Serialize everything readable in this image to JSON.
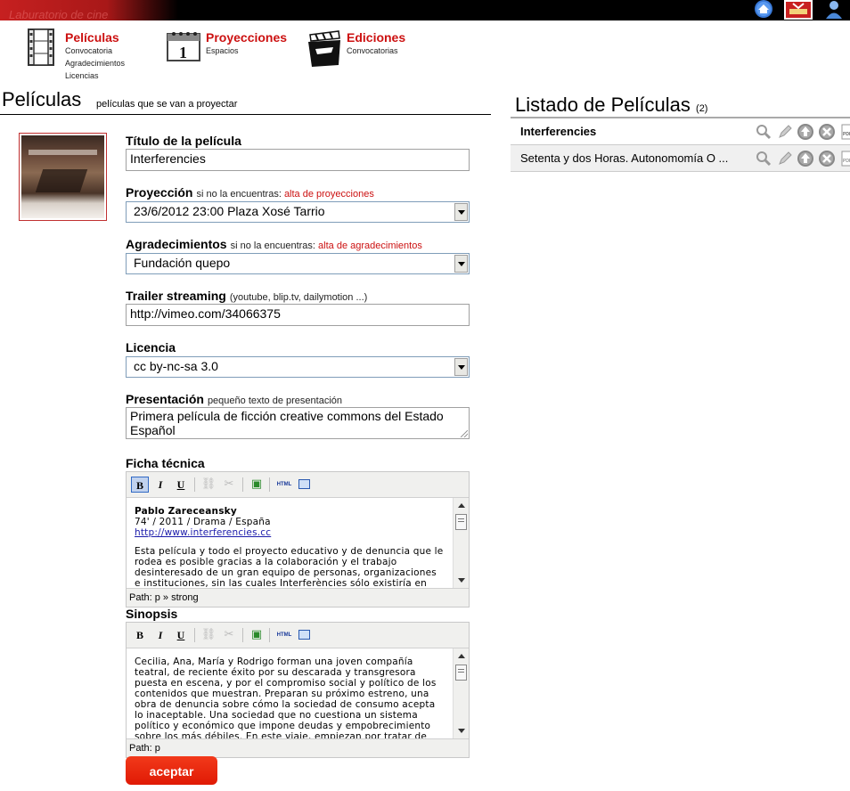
{
  "topbar": {
    "banner_text": "Laburatorio de cine"
  },
  "nav": [
    {
      "title": "Películas",
      "subs": [
        "Convocatoria",
        "Agradecimientos",
        "Licencias"
      ]
    },
    {
      "title": "Proyecciones",
      "subs": [
        "Espacios"
      ]
    },
    {
      "title": "Ediciones",
      "subs": [
        "Convocatorias"
      ]
    }
  ],
  "page": {
    "title": "Películas",
    "subtitle": "películas que se van a proyectar"
  },
  "form": {
    "titulo": {
      "label": "Título de la película",
      "value": "Interferencies"
    },
    "proyeccion": {
      "label": "Proyección",
      "hint": "si no la encuentras:",
      "link": "alta de proyecciones",
      "value": "23/6/2012 23:00 Plaza Xosé Tarrio"
    },
    "agradecimientos": {
      "label": "Agradecimientos",
      "hint": "si no la encuentras:",
      "link": "alta de agradecimientos",
      "value": "Fundación quepo"
    },
    "trailer": {
      "label": "Trailer streaming",
      "hint": "(youtube, blip.tv, dailymotion ...)",
      "value": "http://vimeo.com/34066375"
    },
    "licencia": {
      "label": "Licencia",
      "value": "cc by-nc-sa 3.0"
    },
    "presentacion": {
      "label": "Presentación",
      "hint": "pequeño texto de presentación",
      "value": "Primera película de ficción creative commons del Estado Español"
    },
    "ficha": {
      "label": "Ficha técnica",
      "director": "Pablo Zareceansky",
      "meta": "74' / 2011 / Drama / España",
      "url": "http://www.interferencies.cc",
      "text": "Esta película y todo el proyecto educativo y de denuncia que le rodea es posible gracias a la colaboración y el trabajo desinteresado de un gran equipo de personas, organizaciones e instituciones, sin las cuales Interferències sólo existiría en",
      "path": "Path: p » strong"
    },
    "sinopsis": {
      "label": "Sinopsis",
      "text": "Cecilia, Ana, María y Rodrigo forman una joven compañía teatral, de reciente éxito por su descarada y transgresora puesta en escena, y por el compromiso social y político de los contenidos que muestran. Preparan su próximo estreno, una obra de denuncia sobre cómo la sociedad de consumo acepta lo inaceptable. Una sociedad que no cuestiona un sistema político y económico que impone deudas y empobrecimiento sobre los más débiles. En este viaje, empiezan por tratar de",
      "path": "Path: p"
    },
    "toolbar": {
      "bold": "B",
      "italic": "I",
      "underline": "U",
      "html": "HTML"
    },
    "submit": "aceptar"
  },
  "listado": {
    "title": "Listado de Películas",
    "count": "(2)",
    "rows": [
      "Interferencies",
      "Setenta y dos Horas. Autonomomía O ..."
    ]
  }
}
